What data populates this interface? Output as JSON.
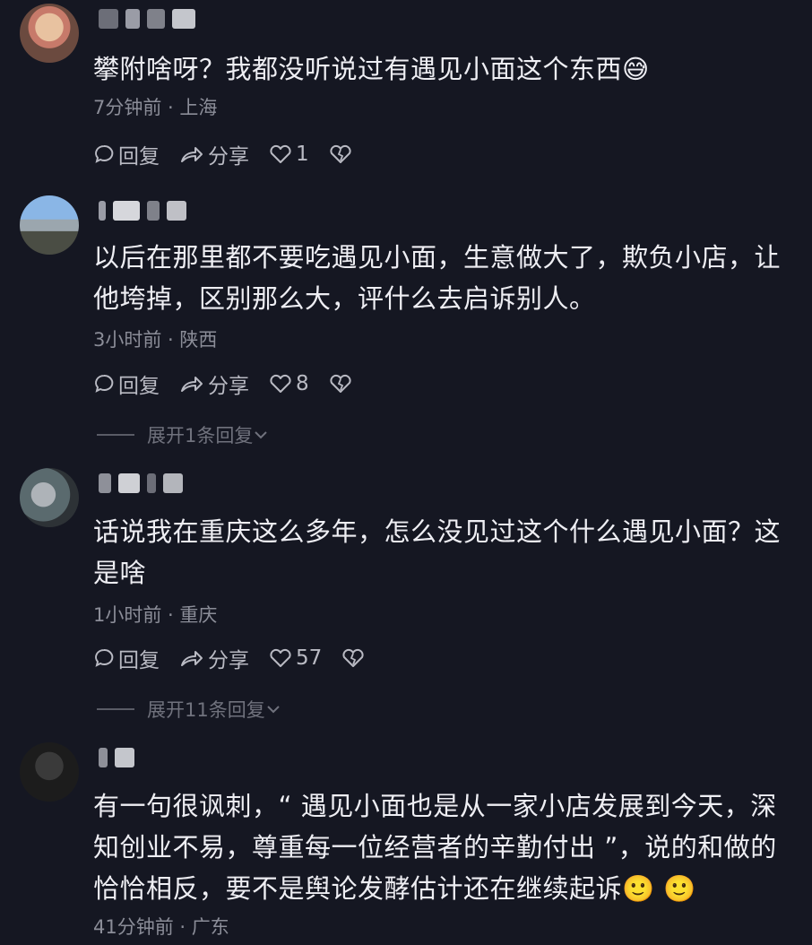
{
  "comments": [
    {
      "text": "攀附啥呀？我都没听说过有遇见小面这个东西😅",
      "time": "7分钟前",
      "location": "上海",
      "reply_label": "回复",
      "share_label": "分享",
      "likes": "1"
    },
    {
      "text": "以后在那里都不要吃遇见小面，生意做大了，欺负小店，让他垮掉，区别那么大，评什么去启诉别人。",
      "time": "3小时前",
      "location": "陕西",
      "reply_label": "回复",
      "share_label": "分享",
      "likes": "8",
      "expand": "展开1条回复"
    },
    {
      "text": "话说我在重庆这么多年，怎么没见过这个什么遇见小面？这是啥",
      "time": "1小时前",
      "location": "重庆",
      "reply_label": "回复",
      "share_label": "分享",
      "likes": "57",
      "expand": "展开11条回复"
    },
    {
      "text": "有一句很讽刺，“ 遇见小面也是从一家小店发展到今天，深知创业不易，尊重每一位经营者的辛勤付出 ”，说的和做的恰恰相反，要不是舆论发酵估计还在继续起诉🙂 🙂",
      "time": "41分钟前",
      "location": "广东"
    }
  ],
  "separator": " · ",
  "colors": {
    "background": "#151722",
    "text": "#eeeef3",
    "meta": "#8b8d98",
    "action": "#b9bac3"
  },
  "icons": [
    "comment-bubble-icon",
    "share-arrow-icon",
    "heart-icon",
    "broken-heart-icon",
    "chevron-down-icon"
  ]
}
